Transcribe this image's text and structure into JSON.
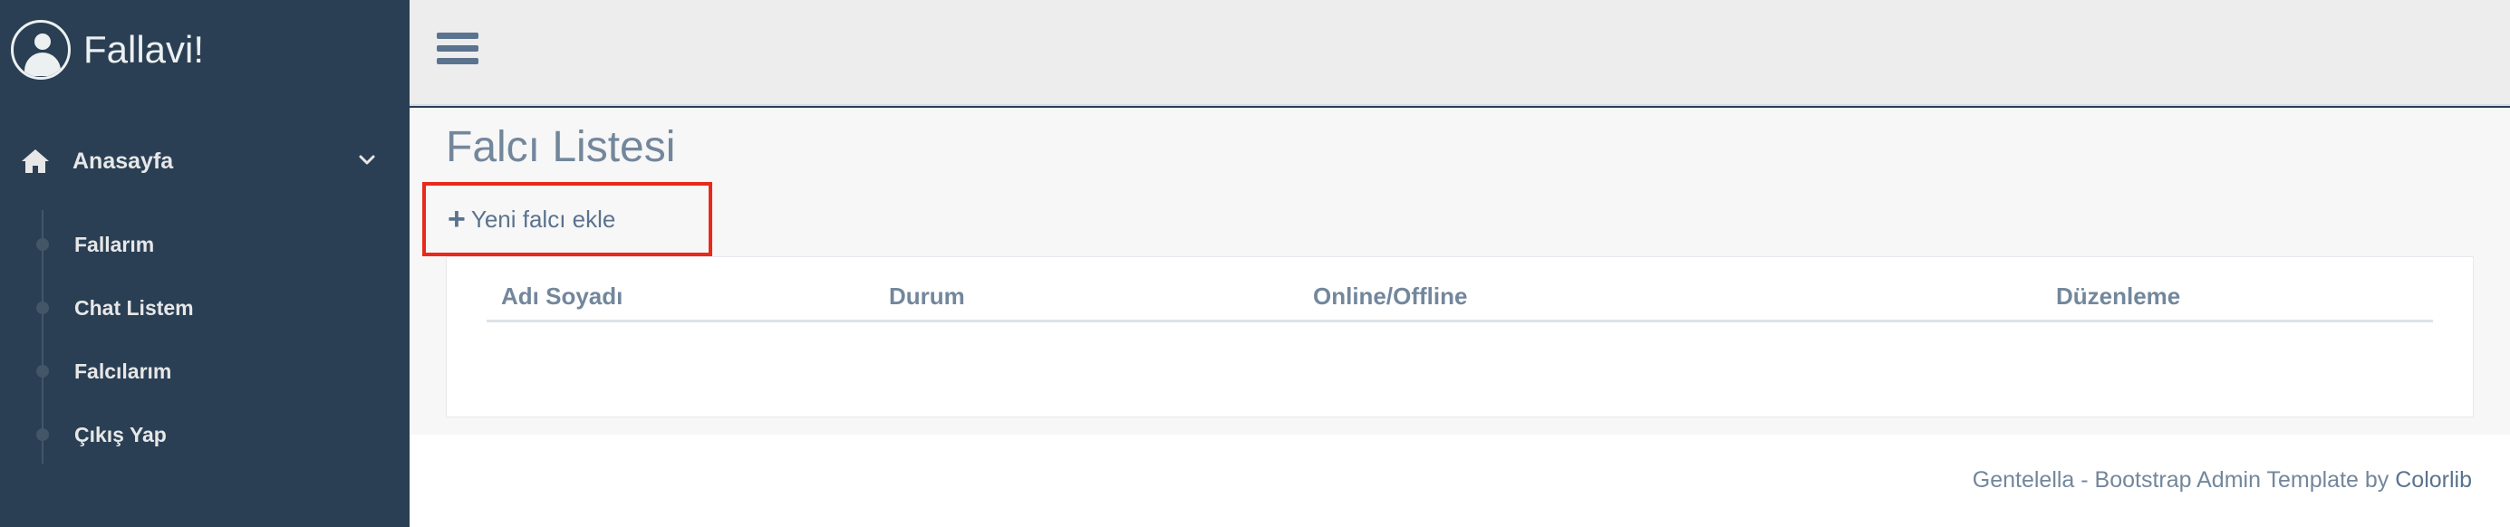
{
  "brand": {
    "name": "Fallavi!",
    "avatar_icon": "user-avatar-icon"
  },
  "sidebar": {
    "main_item": {
      "label": "Anasayfa",
      "icon": "home-icon"
    },
    "items": [
      {
        "label": "Fallarım"
      },
      {
        "label": "Chat Listem"
      },
      {
        "label": "Falcılarım"
      },
      {
        "label": "Çıkış Yap"
      }
    ]
  },
  "page": {
    "title": "Falcı Listesi",
    "add_button": {
      "icon": "plus-icon",
      "label": "Yeni falcı ekle"
    }
  },
  "table": {
    "columns": [
      "Adı Soyadı",
      "Durum",
      "Online/Offline",
      "Düzenleme"
    ],
    "rows": []
  },
  "footer": {
    "text": "Gentelella - Bootstrap Admin Template by ",
    "link": "Colorlib"
  },
  "colors": {
    "sidebar_bg": "#2A3F54",
    "highlight": "#E8291C",
    "text_muted": "#73879C"
  }
}
